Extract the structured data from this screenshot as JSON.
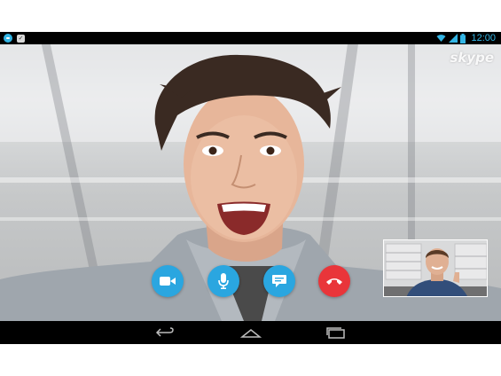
{
  "status_bar": {
    "time": "12:00",
    "notifications": [
      "skype-icon",
      "check-icon"
    ],
    "indicators": [
      "wifi-icon",
      "signal-icon",
      "battery-icon"
    ],
    "accent_color": "#33b5e5"
  },
  "call": {
    "watermark": "skype",
    "remote_video": "remote-participant-video",
    "self_preview": "self-view-video",
    "controls": [
      {
        "name": "video-toggle-button",
        "icon": "video-camera-icon",
        "color": "#2aa6e0"
      },
      {
        "name": "mute-button",
        "icon": "microphone-icon",
        "color": "#2aa6e0"
      },
      {
        "name": "chat-button",
        "icon": "chat-bubble-icon",
        "color": "#2aa6e0"
      },
      {
        "name": "end-call-button",
        "icon": "hang-up-icon",
        "color": "#e9353a"
      }
    ]
  },
  "nav_bar": {
    "buttons": [
      "back-icon",
      "home-icon",
      "recent-apps-icon"
    ]
  }
}
